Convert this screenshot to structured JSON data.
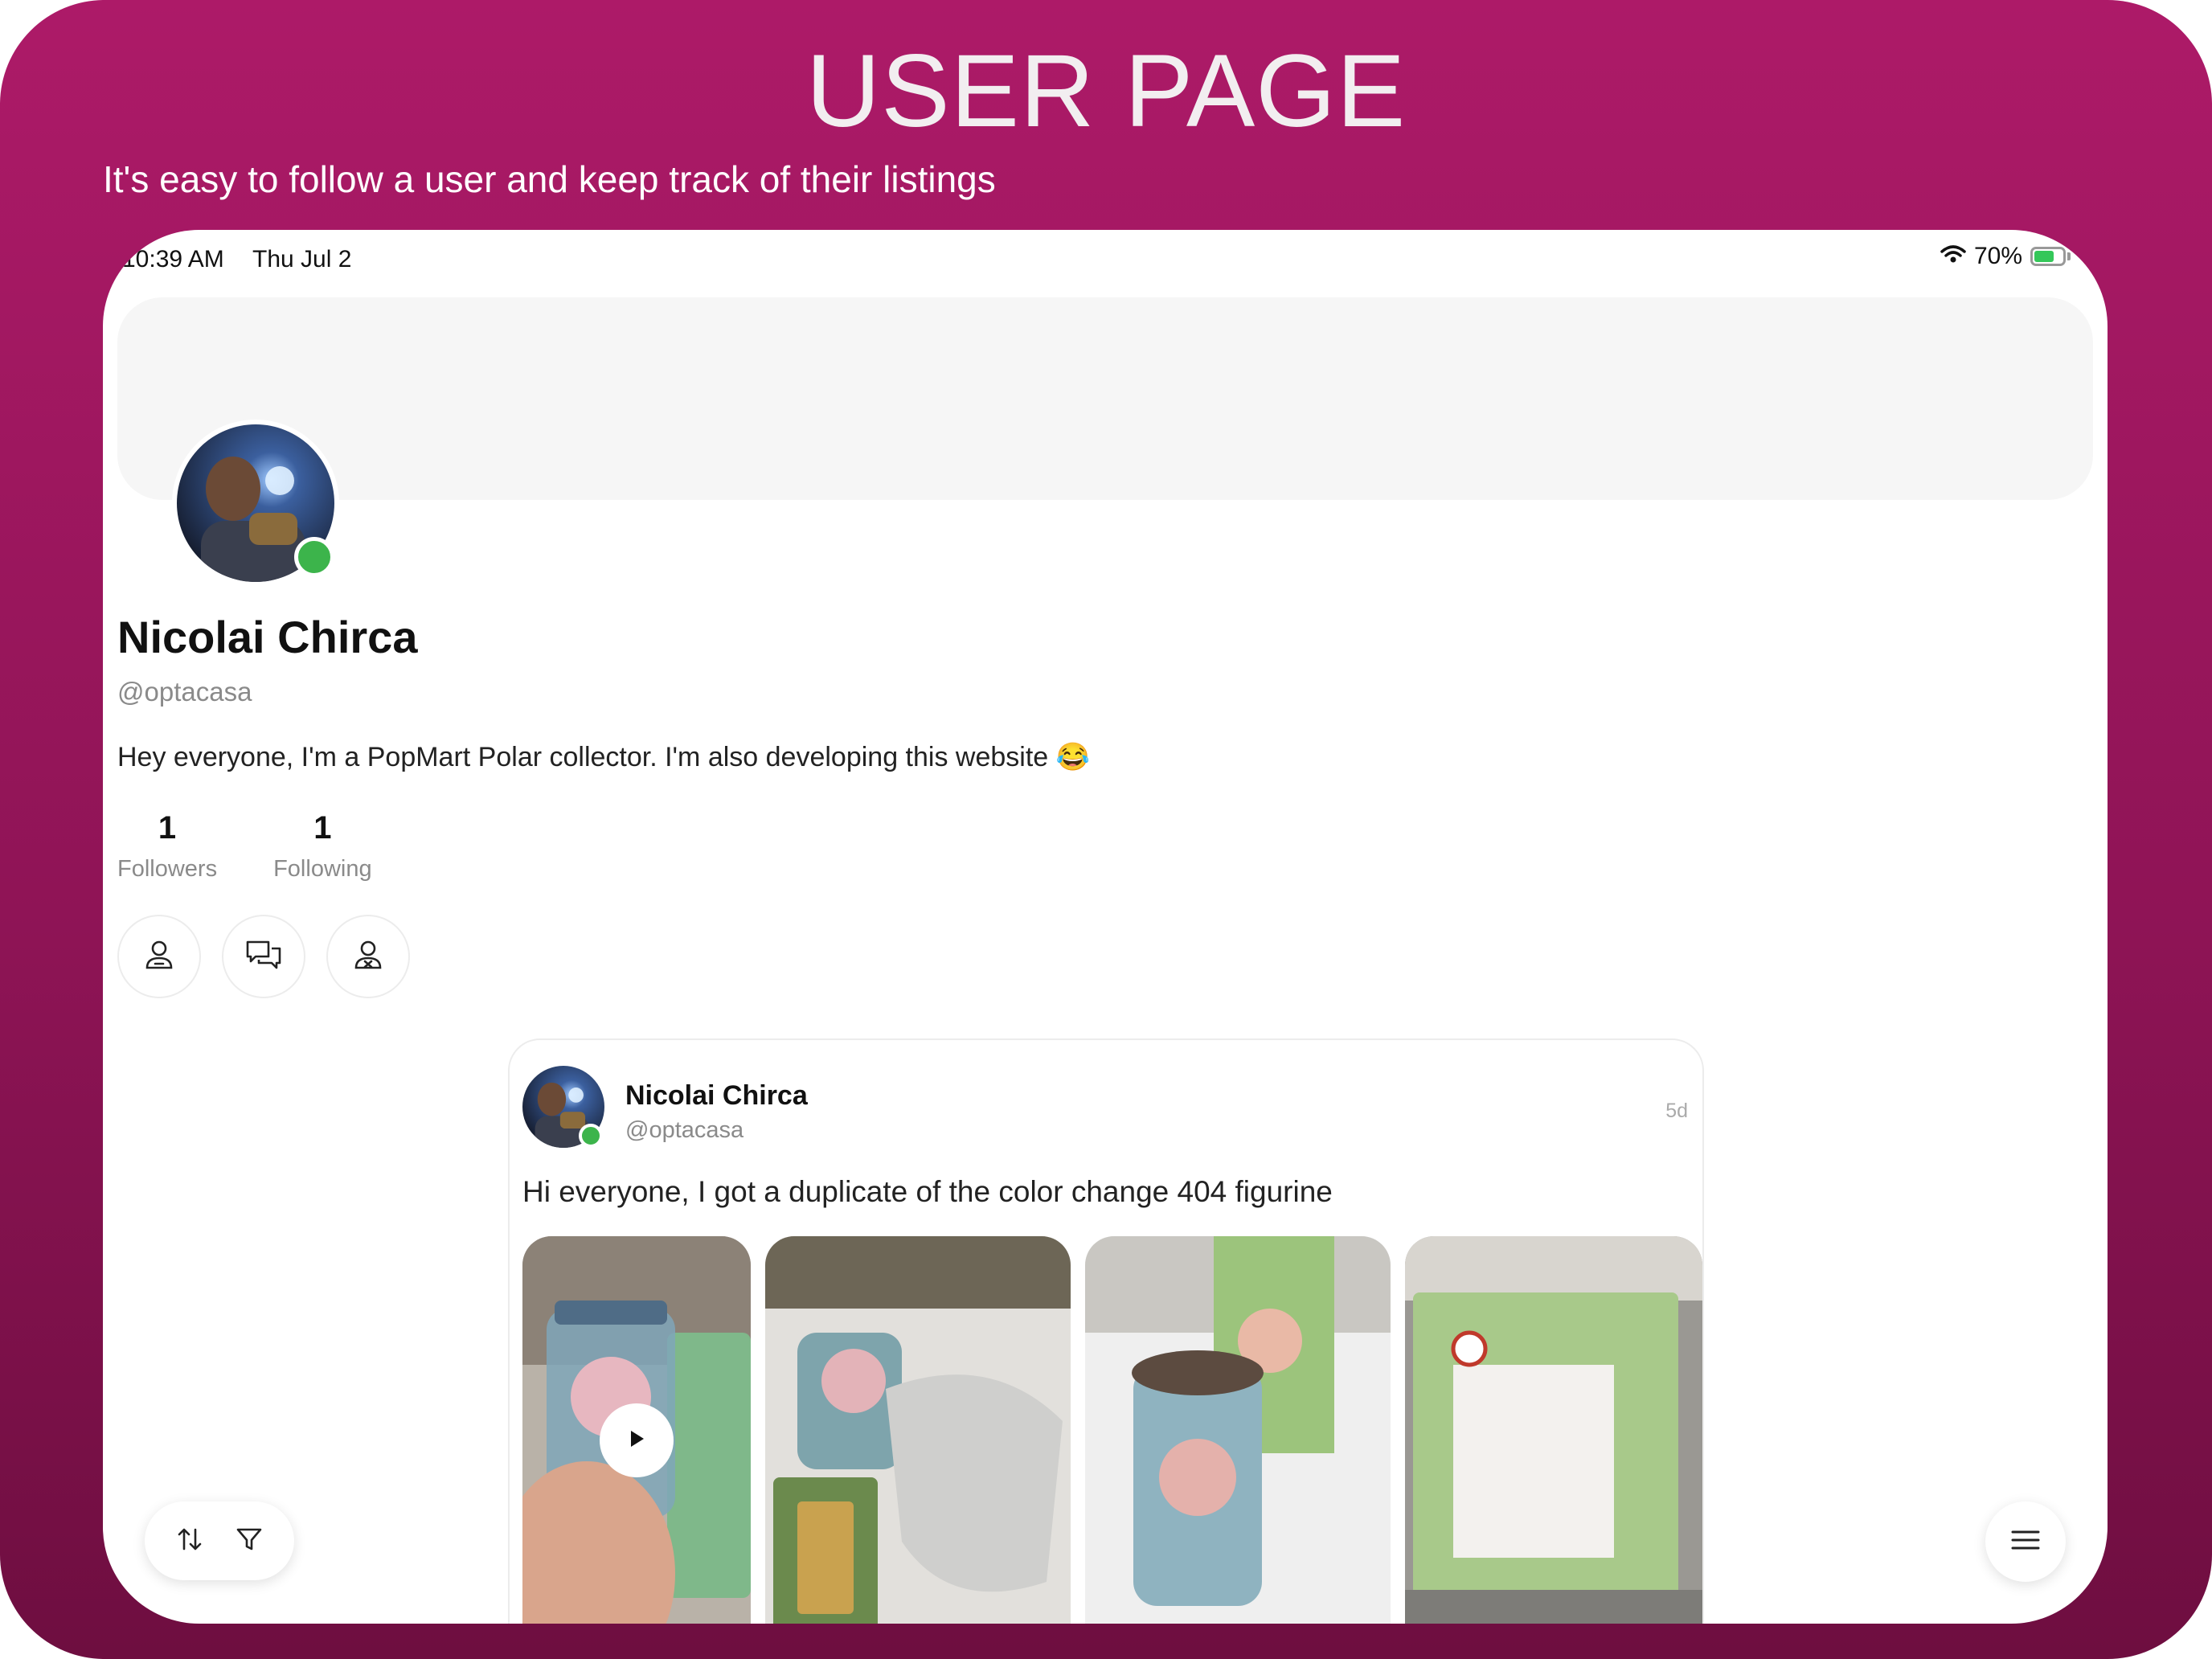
{
  "promo": {
    "headline": "USER PAGE",
    "subline": "It's easy to follow a user and keep track of their listings"
  },
  "status_bar": {
    "time": "10:39 AM",
    "date": "Thu Jul 2",
    "battery": "70%",
    "battery_level": 0.7,
    "icons": [
      "wifi-icon",
      "battery-charging-icon"
    ]
  },
  "profile": {
    "name": "Nicolai Chirca",
    "handle": "@optacasa",
    "bio": "Hey everyone, I'm a PopMart Polar collector. I'm also developing this website 😂",
    "online": true,
    "stats": {
      "followers_count": "1",
      "followers_label": "Followers",
      "following_count": "1",
      "following_label": "Following"
    },
    "actions": [
      "unfollow-user-icon",
      "message-icon",
      "block-user-icon"
    ]
  },
  "post": {
    "author_name": "Nicolai Chirca",
    "author_handle": "@optacasa",
    "time_ago": "5d",
    "text": "Hi everyone, I got a duplicate of the color change 404 figurine",
    "media": [
      {
        "type": "video",
        "description": "hand-holding-jar-figurine"
      },
      {
        "type": "image",
        "description": "jar-figurine-with-card-and-bag"
      },
      {
        "type": "image",
        "description": "jar-figurine-with-polar-box"
      },
      {
        "type": "image",
        "description": "box-label-back"
      }
    ]
  },
  "toolbar": {
    "left_icons": [
      "sort-icon",
      "filter-icon"
    ],
    "right_icon": "menu-icon"
  },
  "colors": {
    "brand_gradient_top": "#ad1a68",
    "brand_gradient_bottom": "#6e0e40",
    "online": "#3cb44b",
    "battery": "#34c759"
  }
}
